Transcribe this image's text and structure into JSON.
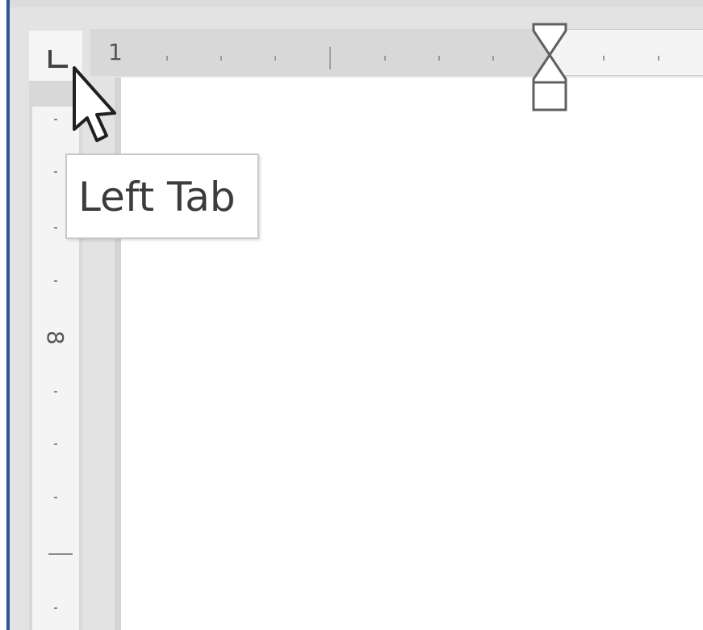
{
  "horizontal_ruler": {
    "margin_label": "1"
  },
  "vertical_ruler": {
    "label": "8"
  },
  "tab_selector": {
    "icon": "left-tab-icon",
    "tooltip": "Left Tab"
  },
  "indent_marker": {
    "icon": "hanging-indent-icon"
  },
  "cursor": {
    "icon": "arrow-pointer-icon"
  },
  "colors": {
    "window_accent": "#2b579a",
    "ruler_margin": "#d8d8d8",
    "ruler_text_area": "#f4f4f4",
    "page": "#ffffff"
  }
}
